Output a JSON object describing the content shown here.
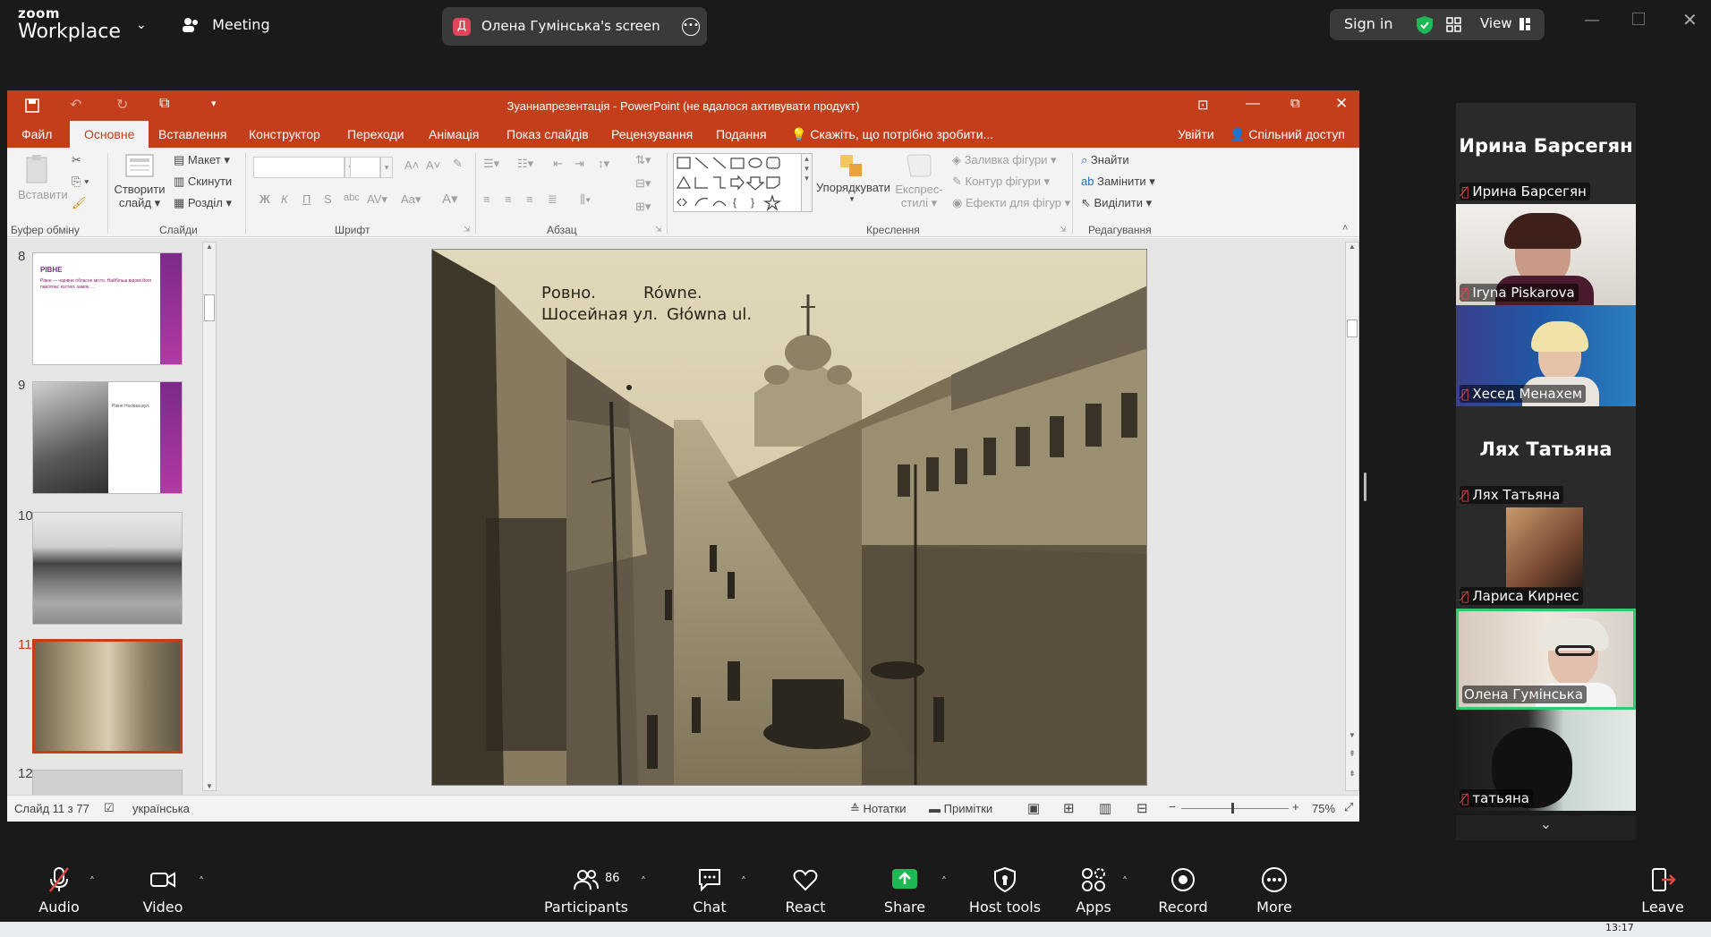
{
  "zoom": {
    "brand_top": "zoom",
    "brand_bottom": "Workplace",
    "meeting_label": "Meeting",
    "share_badge_letter": "Д",
    "share_title": "Олена Гумінська's screen",
    "sign_in": "Sign in",
    "view_label": "View"
  },
  "ppt": {
    "title": "Зуаннапрезентація - PowerPoint (не вдалося активувати продукт)",
    "tabs": [
      "Файл",
      "Основне",
      "Вставлення",
      "Конструктор",
      "Переходи",
      "Анімація",
      "Показ слайдів",
      "Рецензування",
      "Подання"
    ],
    "tell_me": "Скажіть, що потрібно зробити...",
    "sign_in": "Увійти",
    "share": "Спільний доступ",
    "ribbon": {
      "paste": "Вставити",
      "new_slide_1": "Створити",
      "new_slide_2": "слайд",
      "layout": "Макет",
      "reset": "Скинути",
      "section": "Розділ",
      "arrange": "Упорядкувати",
      "quick_styles_1": "Експрес-",
      "quick_styles_2": "стилі",
      "shape_fill": "Заливка фігури",
      "shape_outline": "Контур фігури",
      "shape_effects": "Ефекти для фігур",
      "find": "Знайти",
      "replace": "Замінити",
      "select": "Виділити",
      "groups": {
        "clipboard": "Буфер обміну",
        "slides": "Слайди",
        "font": "Шрифт",
        "paragraph": "Абзац",
        "drawing": "Креслення",
        "editing": "Редагування"
      }
    },
    "thumbnails": [
      {
        "num": "8",
        "title": "РІВНЕ",
        "text": "Рівне — чарівне обласне місто. Найбільш відомі його пам'ятки: костел, замок, ..."
      },
      {
        "num": "9",
        "caption": "Рівне Носівка вул."
      },
      {
        "num": "10"
      },
      {
        "num": "11"
      },
      {
        "num": "12"
      }
    ],
    "slide": {
      "line1a": "Ровно.",
      "line1b": "Równe.",
      "line2a": "Шосейная ул.",
      "line2b": "Główna ul."
    },
    "status": {
      "slide_of": "Слайд 11 з 77",
      "language": "українська",
      "notes": "Нотатки",
      "comments": "Примітки",
      "zoom": "75%"
    }
  },
  "participants": [
    {
      "type": "name",
      "big": "Ирина Барсегян",
      "label": "Ирина Барсегян",
      "muted": true
    },
    {
      "type": "video",
      "label": "Iryna Piskarova",
      "muted": true
    },
    {
      "type": "video",
      "label": "Хесед Менахем",
      "muted": true
    },
    {
      "type": "name",
      "big": "Лях Татьяна",
      "label": "Лях Татьяна",
      "muted": true
    },
    {
      "type": "video",
      "label": "Лариса Кирнес",
      "muted": true
    },
    {
      "type": "video",
      "label": "Олена Гумінська",
      "muted": false,
      "active": true
    },
    {
      "type": "video",
      "label": "татьяна",
      "muted": true
    }
  ],
  "toolbar": {
    "audio": "Audio",
    "video": "Video",
    "participants": "Participants",
    "participants_count": "86",
    "chat": "Chat",
    "react": "React",
    "share": "Share",
    "host_tools": "Host tools",
    "apps": "Apps",
    "record": "Record",
    "more": "More",
    "leave": "Leave"
  },
  "clock": "13:17",
  "colors": {
    "ppt_accent": "#c43e1c",
    "zoom_bg": "#1a1a1a",
    "share_green": "#1db954",
    "active_speaker": "#2ecc71"
  }
}
